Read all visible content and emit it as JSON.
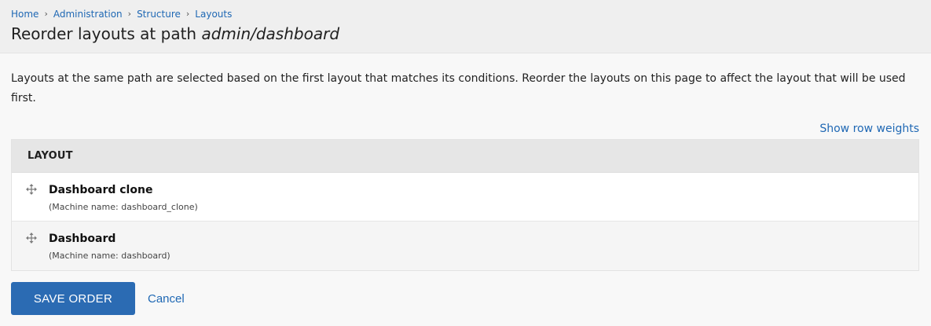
{
  "breadcrumb": {
    "items": [
      "Home",
      "Administration",
      "Structure",
      "Layouts"
    ]
  },
  "page": {
    "title_prefix": "Reorder layouts at path ",
    "title_path": "admin/dashboard",
    "description": "Layouts at the same path are selected based on the first layout that matches its conditions. Reorder the layouts on this page to affect the layout that will be used first."
  },
  "table": {
    "show_weights_label": "Show row weights",
    "column_header": "LAYOUT",
    "rows": [
      {
        "title": "Dashboard clone",
        "machine_name": "(Machine name: dashboard_clone)"
      },
      {
        "title": "Dashboard",
        "machine_name": "(Machine name: dashboard)"
      }
    ]
  },
  "actions": {
    "save_label": "SAVE ORDER",
    "cancel_label": "Cancel"
  },
  "colors": {
    "link": "#1f68b4",
    "primary_button": "#2b6bb3",
    "header_bg": "#efefef"
  },
  "icons": {
    "breadcrumb_separator": "chevron-right-icon",
    "row_handle": "drag-handle-icon"
  }
}
